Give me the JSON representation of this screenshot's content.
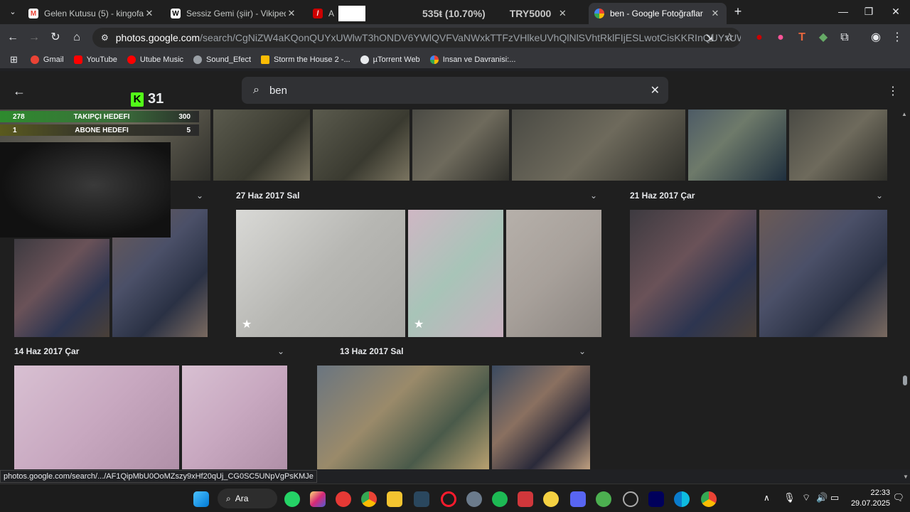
{
  "tabs": [
    {
      "title": "Gelen Kutusu (5) - kingofassian",
      "fav": "gmail-icon",
      "color": "#ea4335"
    },
    {
      "title": "Sessiz Gemi (şiir) - Vikipedi",
      "fav": "wikipedia-icon",
      "color": "#ffffff"
    },
    {
      "title": "A",
      "fav": "app-icon",
      "color": "#ea4335"
    },
    {
      "title": "ben - Google Fotoğraflar",
      "fav": "google-photos-icon",
      "color": "#fbbc04"
    }
  ],
  "ticker": {
    "change": "535ŧ (10.70%)",
    "price": "TRY5000"
  },
  "address": {
    "host": "photos.google.com",
    "path": "/search/CgNiZW4aKQonQUYxUWlwT3hONDV6YWlQVFVaNWxkTTFzVHlkeUVhQlNlSVhtRklFIjESLwotCisKKRInQUYxUWlwT3hONDV6YWlQ..."
  },
  "bookmarks": [
    {
      "label": "Gmail",
      "color": "#ea4335"
    },
    {
      "label": "YouTube",
      "color": "#ff0000"
    },
    {
      "label": "Utube Music",
      "color": "#ff0000"
    },
    {
      "label": "Sound_Efect",
      "color": "#9aa0a6"
    },
    {
      "label": "Storm the House 2 -...",
      "color": "#fbbc04"
    },
    {
      "label": "µTorrent Web",
      "color": "#e8eaed"
    },
    {
      "label": "Insan ve Davranisi:...",
      "color": "#4285f4"
    }
  ],
  "search": {
    "query": "ben"
  },
  "stream": {
    "logo": "K",
    "count": "31"
  },
  "goals": [
    {
      "left": "278",
      "label": "TAKIPÇI HEDEFI",
      "right": "300",
      "color": "#2e8b2e"
    },
    {
      "left": "1",
      "label": "ABONE HEDEFI",
      "right": "5",
      "color": "#5a5a1e"
    }
  ],
  "sections": [
    {
      "date": "27 Haz 2017 Sal"
    },
    {
      "date": "21 Haz 2017 Çar"
    },
    {
      "date": "14 Haz 2017 Çar"
    },
    {
      "date": "13 Haz 2017 Sal"
    }
  ],
  "status_url": "photos.google.com/search/.../AF1QipMbU0OoMZszy9xHf20qUj_CG0SC5UNpVgPsKMJe",
  "taskbar": {
    "search_label": "Ara",
    "time": "22:33",
    "date": "29.07.2025"
  }
}
